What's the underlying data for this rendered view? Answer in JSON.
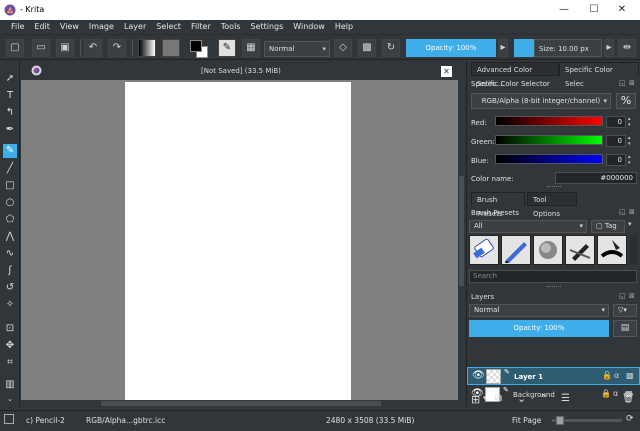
{
  "window": {
    "title": "- Krita",
    "minimize": "—",
    "maximize": "☐",
    "close": "✕"
  },
  "menu": [
    "File",
    "Edit",
    "View",
    "Image",
    "Layer",
    "Select",
    "Filter",
    "Tools",
    "Settings",
    "Window",
    "Help"
  ],
  "toolbar": {
    "blend_mode": "Normal",
    "opacity": "Opacity: 100%",
    "size": "Size: 10.00 px"
  },
  "canvas": {
    "title": "[Not Saved]  (33.5 MiB)",
    "close": "✕"
  },
  "color_tabs": {
    "advanced": "Advanced Color Selec...",
    "specific": "Specific Color Selec"
  },
  "specific_color": {
    "title": "Specific Color Selector",
    "model": "RGB/Alpha (8-bit integer/channel)",
    "percent": "%",
    "red_label": "Red:",
    "red_value": "0",
    "green_label": "Green:",
    "green_value": "0",
    "blue_label": "Blue:",
    "blue_value": "0",
    "color_name_label": "Color name:",
    "color_name_value": "#000000"
  },
  "brush_tabs": {
    "presets": "Brush Presets",
    "tool_options": "Tool Options"
  },
  "brush_presets": {
    "title": "Brush Presets",
    "filter": "All",
    "tag": "Tag",
    "search_placeholder": "Search"
  },
  "layers": {
    "title": "Layers",
    "blend_mode": "Normal",
    "opacity": "Opacity: 100%",
    "items": [
      {
        "name": "Layer 1",
        "selected": true
      },
      {
        "name": "Background",
        "selected": false
      }
    ]
  },
  "status": {
    "brush": "c) Pencil-2",
    "color_profile": "RGB/Alpha...gbtrc.icc",
    "dimensions": "2480 x 3508 (33.5 MiB)",
    "zoom": "Fit Page"
  },
  "colors": {
    "accent": "#3daee9",
    "bg": "#31363b",
    "canvas": "#808080"
  }
}
